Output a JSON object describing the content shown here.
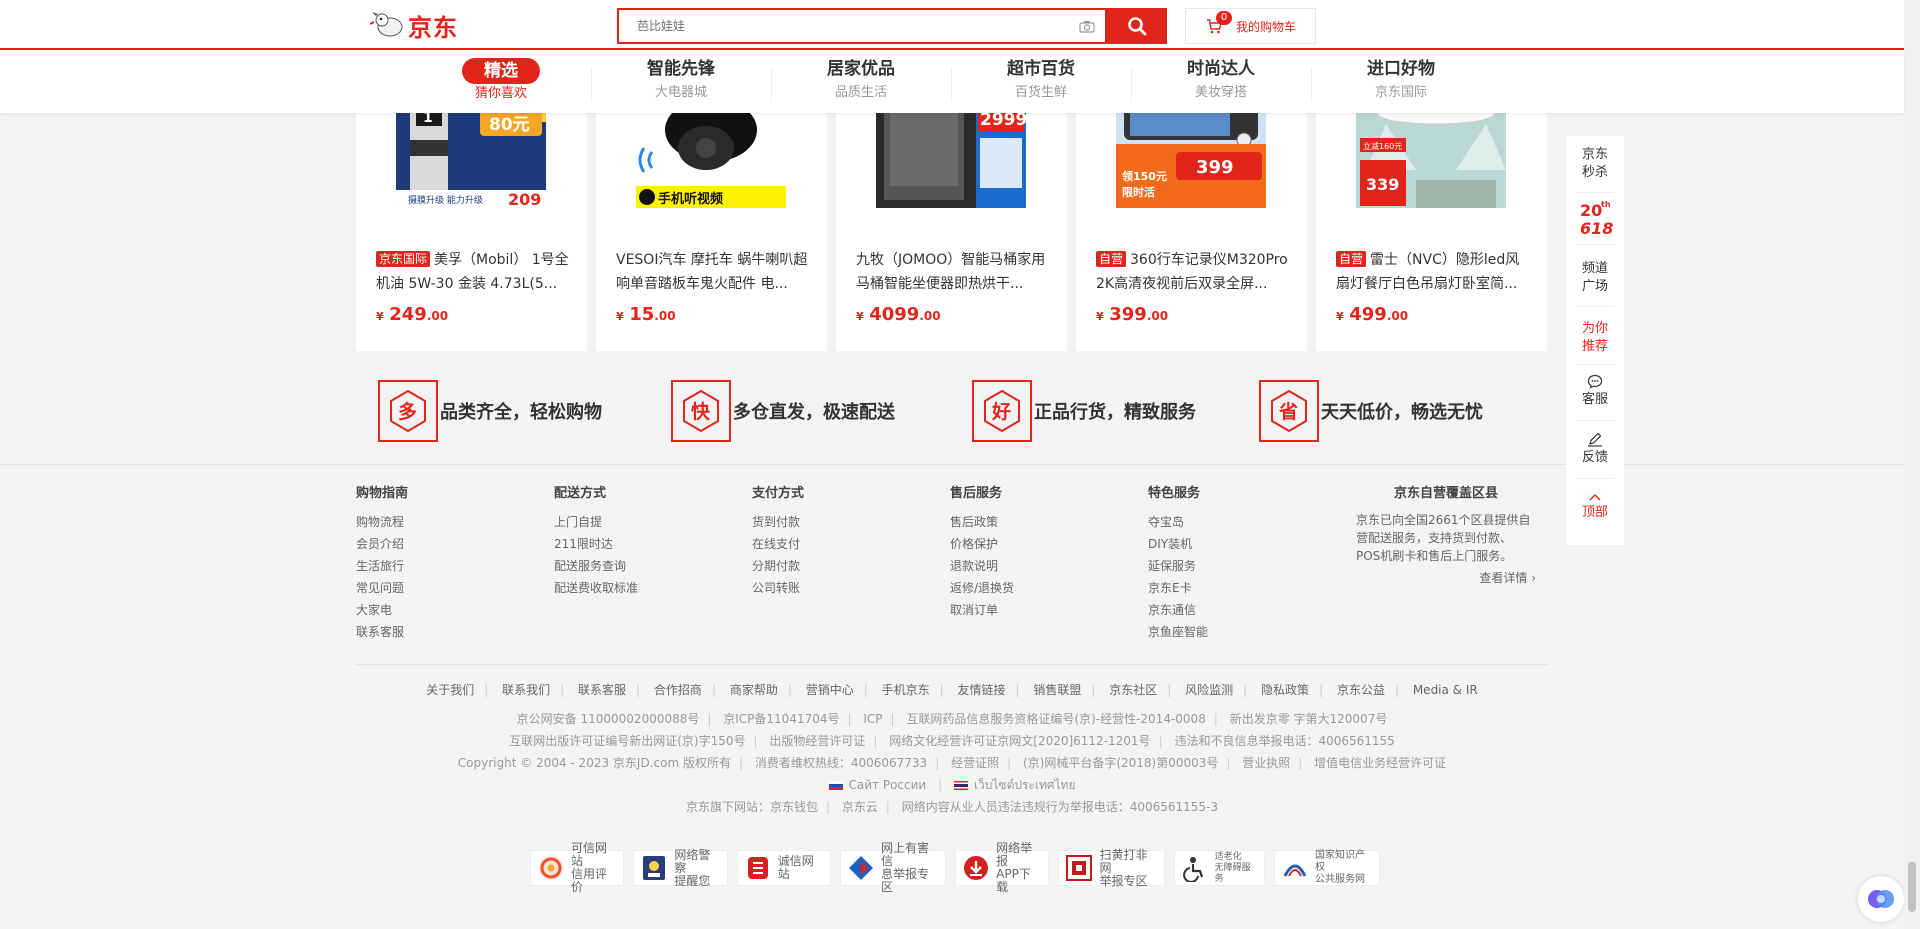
{
  "header": {
    "logo_text": "京东",
    "search_placeholder": "芭比娃娃",
    "cart_count": "0",
    "cart_label": "我的购物车"
  },
  "tabs": [
    {
      "main": "精选",
      "sub": "猜你喜欢",
      "active": true
    },
    {
      "main": "智能先锋",
      "sub": "大电器城"
    },
    {
      "main": "居家优品",
      "sub": "品质生活"
    },
    {
      "main": "超市百货",
      "sub": "百货生鲜"
    },
    {
      "main": "时尚达人",
      "sub": "美妆穿搭"
    },
    {
      "main": "进口好物",
      "sub": "京东国际"
    }
  ],
  "products": [
    {
      "tag": "京东国际",
      "title": "美孚（Mobil） 1号全机油 5W-30 金装 4.73L(5...",
      "price_int": "249",
      "price_dec": ".00",
      "currency": "¥",
      "img_text": [
        "80元",
        "209"
      ]
    },
    {
      "tag": "",
      "title": "VESOI汽车 摩托车 蜗牛喇叭超响单音踏板车鬼火配件 电...",
      "price_int": "15",
      "price_dec": ".00",
      "currency": "¥",
      "img_text": [
        "手机听视频"
      ]
    },
    {
      "tag": "",
      "title": "九牧（JOMOO）智能马桶家用马桶智能坐便器即热烘干...",
      "price_int": "4099",
      "price_dec": ".00",
      "currency": "¥",
      "img_text": [
        "2999"
      ]
    },
    {
      "tag": "自营",
      "title": "360行车记录仪M320Pro 2K高清夜视前后双录全屏...",
      "price_int": "399",
      "price_dec": ".00",
      "currency": "¥",
      "img_text": [
        "399",
        "领150元",
        "限时活"
      ]
    },
    {
      "tag": "自营",
      "title": "雷士（NVC）隐形led风扇灯餐厅白色吊扇灯卧室简...",
      "price_int": "499",
      "price_dec": ".00",
      "currency": "¥",
      "img_text": [
        "立减160元",
        "339"
      ]
    }
  ],
  "services": [
    {
      "char": "多",
      "text": "品类齐全，轻松购物"
    },
    {
      "char": "快",
      "text": "多仓直发，极速配送"
    },
    {
      "char": "好",
      "text": "正品行货，精致服务"
    },
    {
      "char": "省",
      "text": "天天低价，畅选无忧"
    }
  ],
  "footer_columns": [
    {
      "title": "购物指南",
      "links": [
        "购物流程",
        "会员介绍",
        "生活旅行",
        "常见问题",
        "大家电",
        "联系客服"
      ]
    },
    {
      "title": "配送方式",
      "links": [
        "上门自提",
        "211限时达",
        "配送服务查询",
        "配送费收取标准"
      ]
    },
    {
      "title": "支付方式",
      "links": [
        "货到付款",
        "在线支付",
        "分期付款",
        "公司转账"
      ]
    },
    {
      "title": "售后服务",
      "links": [
        "售后政策",
        "价格保护",
        "退款说明",
        "返修/退换货",
        "取消订单"
      ]
    },
    {
      "title": "特色服务",
      "links": [
        "夺宝岛",
        "DIY装机",
        "延保服务",
        "京东E卡",
        "京东通信",
        "京鱼座智能"
      ]
    }
  ],
  "coverage": {
    "title": "京东自营覆盖区县",
    "text": "京东已向全国2661个区县提供自营配送服务，支持货到付款、POS机刷卡和售后上门服务。",
    "more": "查看详情 ›"
  },
  "footer_links": [
    "关于我们",
    "联系我们",
    "联系客服",
    "合作招商",
    "商家帮助",
    "营销中心",
    "手机京东",
    "友情链接",
    "销售联盟",
    "京东社区",
    "风险监测",
    "隐私政策",
    "京东公益",
    "Media & IR"
  ],
  "copyright_rows": [
    [
      "京公网安备 11000002000088号",
      "京ICP备11041704号",
      "ICP",
      "互联网药品信息服务资格证编号(京)-经营性-2014-0008",
      "新出发京零 字第大120007号"
    ],
    [
      "互联网出版许可证编号新出网证(京)字150号",
      "出版物经营许可证",
      "网络文化经营许可证京网文[2020]6112-1201号",
      "违法和不良信息举报电话：4006561155"
    ],
    [
      "Copyright © 2004 - 2023  京东JD.com 版权所有",
      "消费者维权热线：4006067733",
      "经营证照",
      "(京)网械平台备字(2018)第00003号",
      "营业执照",
      "增值电信业务经营许可证"
    ],
    [
      "京东旗下网站：京东钱包",
      "京东云",
      "网络内容从业人员违法违规行为举报电话：4006561155-3"
    ]
  ],
  "intl_links": {
    "ru": "Сайт России",
    "th": "เว็บไซต์ประเทศไทย"
  },
  "badges": [
    {
      "l1": "可信网站",
      "l2": "信用评价",
      "icon": "credit-icon",
      "color": "#e8542a"
    },
    {
      "l1": "网络警察",
      "l2": "提醒您",
      "icon": "police-icon",
      "color": "#2a3f7a"
    },
    {
      "l1": "诚信网站",
      "l2": "",
      "icon": "integrity-icon",
      "color": "#d42020"
    },
    {
      "l1": "网上有害信",
      "l2": "息举报专区",
      "icon": "report-icon",
      "color": "#1f5fbf"
    },
    {
      "l1": "网络举报",
      "l2": "APP下载",
      "icon": "app-icon",
      "color": "#d42020"
    },
    {
      "l1": "扫黄打非网",
      "l2": "举报专区",
      "icon": "anti-porn-icon",
      "color": "#c21a1a"
    },
    {
      "l1": "适老化",
      "l2": "无障碍服务",
      "icon": "accessibility-icon",
      "color": "#333333"
    },
    {
      "l1": "国家知识产权",
      "l2": "公共服务网",
      "icon": "ip-icon",
      "color": "#1f5fbf"
    }
  ],
  "sidebar": {
    "seckill": "京东秒杀",
    "promo": "20th 618",
    "channel": "频道广场",
    "recommend": "为你推荐",
    "service": "客服",
    "feedback": "反馈",
    "top": "顶部"
  },
  "colors": {
    "brand": "#e1251b"
  }
}
